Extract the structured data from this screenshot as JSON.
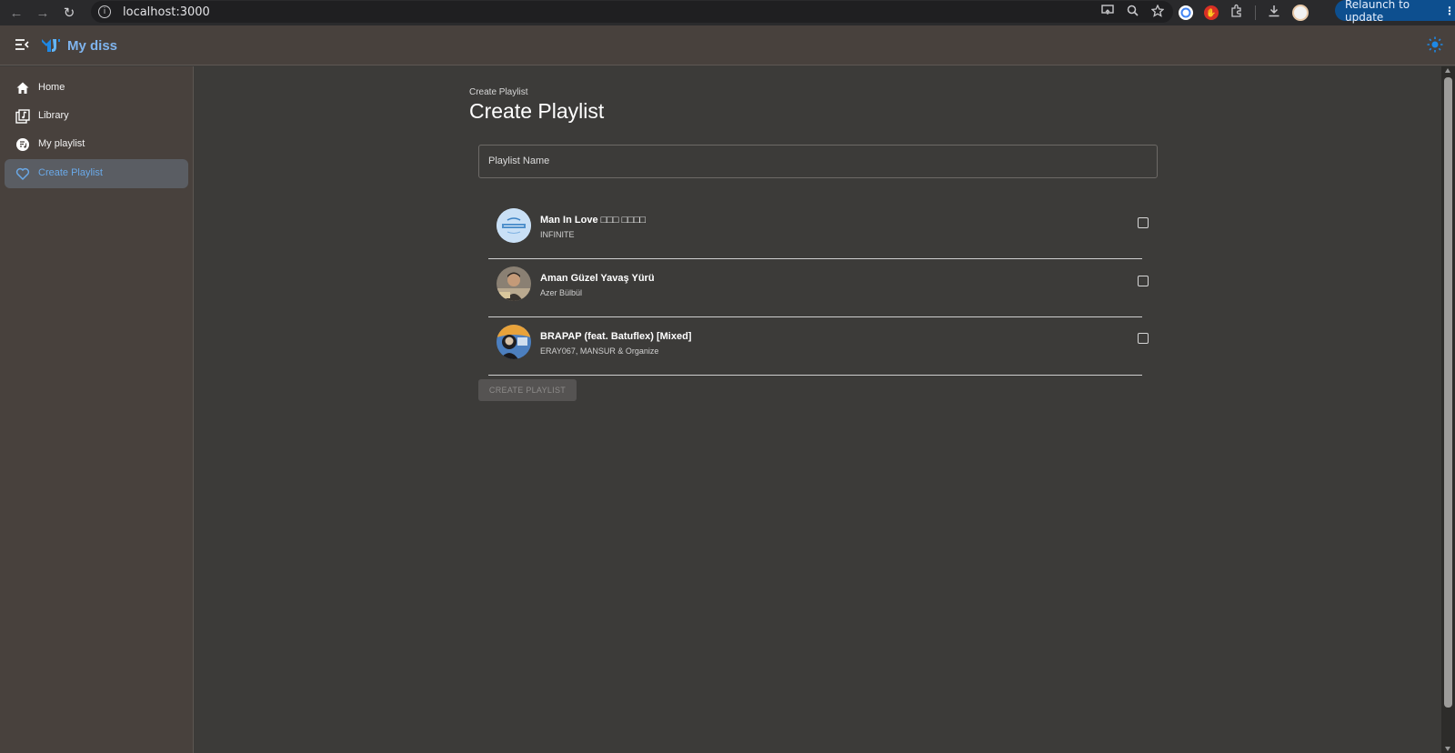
{
  "browser": {
    "url": "localhost:3000",
    "relaunch_label": "Relaunch to update",
    "icons": [
      "back-icon",
      "forward-icon",
      "reload-icon",
      "site-info-icon",
      "cast-icon",
      "zoom-icon",
      "bookmark-star-icon",
      "extensions-icon",
      "download-icon",
      "profile-avatar",
      "menu-dots-icon"
    ]
  },
  "app": {
    "title": "My diss",
    "brand_color": "#7fb4ee",
    "accent_color": "#1e88e5"
  },
  "sidebar": {
    "items": [
      {
        "label": "Home",
        "icon": "home-icon",
        "selected": false
      },
      {
        "label": "Library",
        "icon": "library-icon",
        "selected": false
      },
      {
        "label": "My playlist",
        "icon": "my-playlist-icon",
        "selected": false
      },
      {
        "label": "Create Playlist",
        "icon": "heart-icon",
        "selected": true
      }
    ]
  },
  "main": {
    "breadcrumb": "Create Playlist",
    "title": "Create Playlist",
    "playlist_name_placeholder": "Playlist Name",
    "tracks": [
      {
        "name": "Man In Love □□□ □□□□",
        "artist": "INFINITE",
        "checked": false
      },
      {
        "name": "Aman Güzel Yavaş Yürü",
        "artist": "Azer Bülbül",
        "checked": false
      },
      {
        "name": "BRAPAP (feat. Batuflex) [Mixed]",
        "artist": "ERAY067, MANSUR & Organize",
        "checked": false
      }
    ],
    "create_button_label": "CREATE PLAYLIST",
    "create_button_disabled": true
  }
}
